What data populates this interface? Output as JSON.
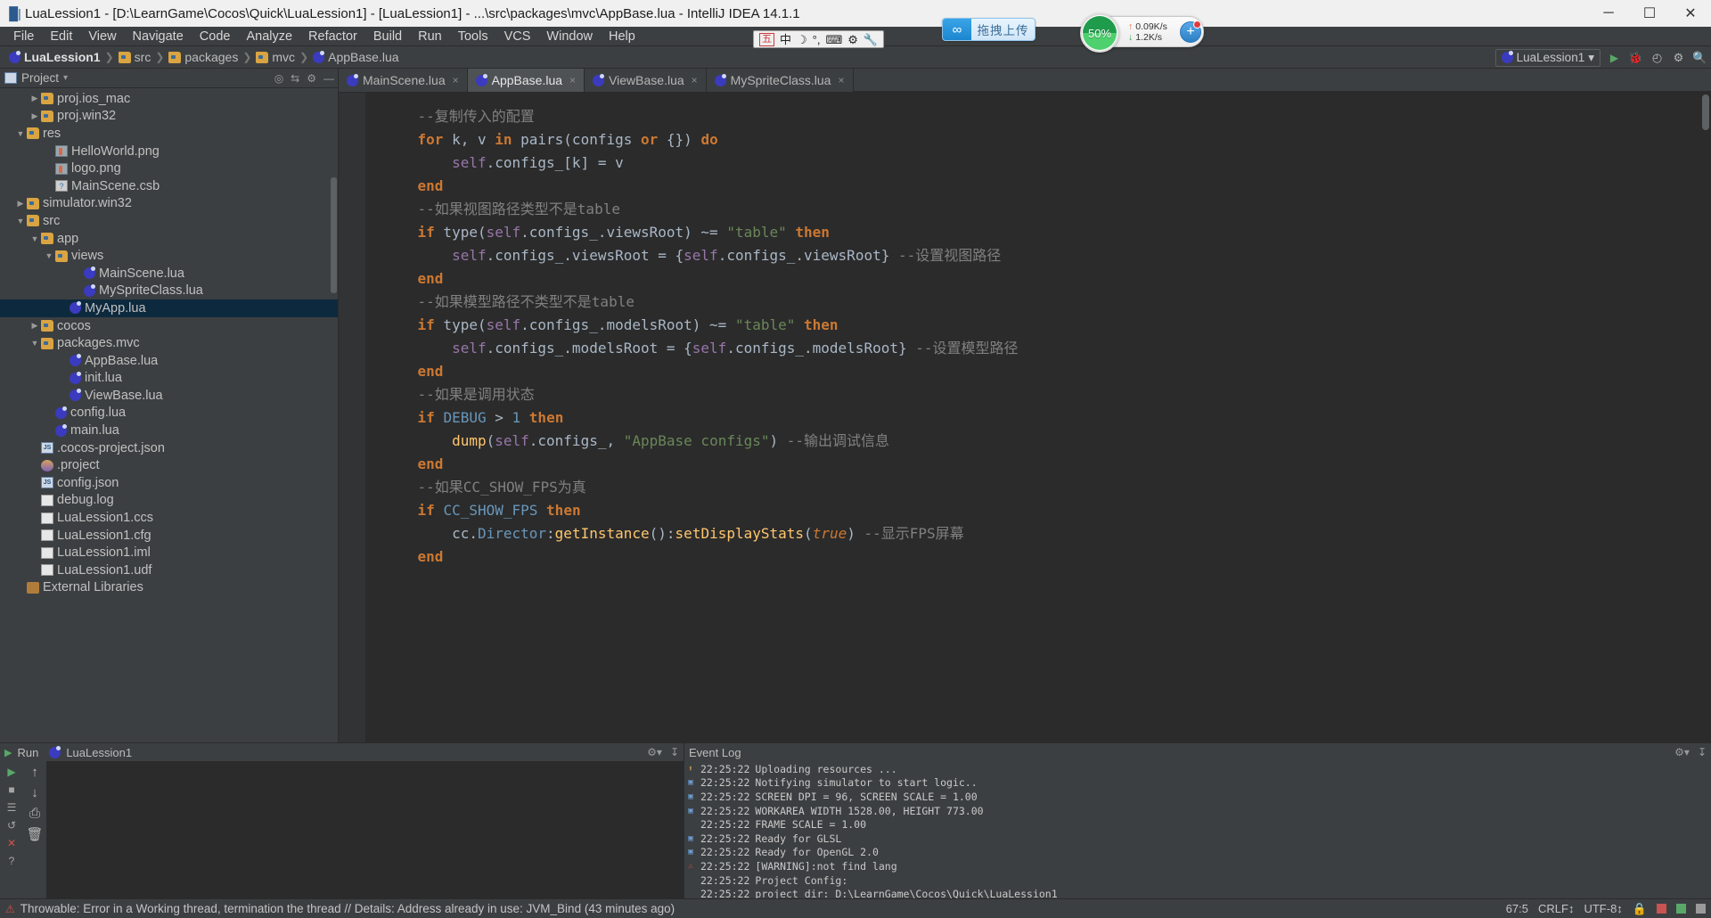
{
  "window": {
    "title": "LuaLession1 - [D:\\LearnGame\\Cocos\\Quick\\LuaLession1] - [LuaLession1] - ...\\src\\packages\\mvc\\AppBase.lua - IntelliJ IDEA 14.1.1",
    "minimize": "─",
    "maximize": "☐",
    "close": "✕"
  },
  "menu": {
    "items": [
      "File",
      "Edit",
      "View",
      "Navigate",
      "Code",
      "Analyze",
      "Refactor",
      "Build",
      "Run",
      "Tools",
      "VCS",
      "Window",
      "Help"
    ]
  },
  "ime": {
    "mode_box": "五",
    "lang": "中",
    "moon": "☽",
    "punct": "°,",
    "keyboard": "⌨",
    "tools": "⚙",
    "wrench": "🔧"
  },
  "upload_widget": {
    "label": "拖拽上传",
    "logo": "∞"
  },
  "net_widget": {
    "percent": "50%",
    "up_arrow": "↑",
    "up_speed": "0.09K/s",
    "down_arrow": "↓",
    "down_speed": "1.2K/s",
    "plus": "+"
  },
  "breadcrumb": {
    "items": [
      {
        "label": "LuaLession1",
        "icon": "project-icon"
      },
      {
        "label": "src",
        "icon": "folder-icon"
      },
      {
        "label": "packages",
        "icon": "folder-icon"
      },
      {
        "label": "mvc",
        "icon": "folder-icon"
      },
      {
        "label": "AppBase.lua",
        "icon": "lua-file-icon"
      }
    ],
    "separator": "❯"
  },
  "toolbar_right": {
    "run_config": "LuaLession1",
    "chevron": "▾",
    "run": "▶",
    "debug": "🐞",
    "coverage": "◴",
    "settings": "⚙",
    "search": "🔍"
  },
  "project_panel": {
    "title": "Project",
    "chevron": "▾",
    "icons": [
      "collapse-all-icon",
      "target-icon",
      "settings-icon",
      "hide-icon"
    ],
    "tree": [
      {
        "indent": 2,
        "twisty": "▶",
        "icon": "folder",
        "label": "proj.ios_mac",
        "selected": false
      },
      {
        "indent": 2,
        "twisty": "▶",
        "icon": "folder",
        "label": "proj.win32",
        "selected": false
      },
      {
        "indent": 1,
        "twisty": "▼",
        "icon": "folder",
        "label": "res",
        "selected": false
      },
      {
        "indent": 3,
        "twisty": "",
        "icon": "png",
        "label": "HelloWorld.png",
        "selected": false
      },
      {
        "indent": 3,
        "twisty": "",
        "icon": "png",
        "label": "logo.png",
        "selected": false
      },
      {
        "indent": 3,
        "twisty": "",
        "icon": "csb",
        "label": "MainScene.csb",
        "selected": false
      },
      {
        "indent": 1,
        "twisty": "▶",
        "icon": "folder",
        "label": "simulator.win32",
        "selected": false
      },
      {
        "indent": 1,
        "twisty": "▼",
        "icon": "folder",
        "label": "src",
        "selected": false
      },
      {
        "indent": 2,
        "twisty": "▼",
        "icon": "folder",
        "label": "app",
        "selected": false
      },
      {
        "indent": 3,
        "twisty": "▼",
        "icon": "folder",
        "label": "views",
        "selected": false
      },
      {
        "indent": 5,
        "twisty": "",
        "icon": "lua",
        "label": "MainScene.lua",
        "selected": false
      },
      {
        "indent": 5,
        "twisty": "",
        "icon": "lua",
        "label": "MySpriteClass.lua",
        "selected": false
      },
      {
        "indent": 4,
        "twisty": "",
        "icon": "lua",
        "label": "MyApp.lua",
        "selected": true
      },
      {
        "indent": 2,
        "twisty": "▶",
        "icon": "folder",
        "label": "cocos",
        "selected": false
      },
      {
        "indent": 2,
        "twisty": "▼",
        "icon": "folder",
        "label": "packages.mvc",
        "selected": false
      },
      {
        "indent": 4,
        "twisty": "",
        "icon": "lua",
        "label": "AppBase.lua",
        "selected": false
      },
      {
        "indent": 4,
        "twisty": "",
        "icon": "lua",
        "label": "init.lua",
        "selected": false
      },
      {
        "indent": 4,
        "twisty": "",
        "icon": "lua",
        "label": "ViewBase.lua",
        "selected": false
      },
      {
        "indent": 3,
        "twisty": "",
        "icon": "lua",
        "label": "config.lua",
        "selected": false
      },
      {
        "indent": 3,
        "twisty": "",
        "icon": "lua",
        "label": "main.lua",
        "selected": false
      },
      {
        "indent": 2,
        "twisty": "",
        "icon": "json",
        "label": ".cocos-project.json",
        "selected": false
      },
      {
        "indent": 2,
        "twisty": "",
        "icon": "proj",
        "label": ".project",
        "selected": false
      },
      {
        "indent": 2,
        "twisty": "",
        "icon": "json",
        "label": "config.json",
        "selected": false
      },
      {
        "indent": 2,
        "twisty": "",
        "icon": "txt",
        "label": "debug.log",
        "selected": false
      },
      {
        "indent": 2,
        "twisty": "",
        "icon": "ccs",
        "label": "LuaLession1.ccs",
        "selected": false
      },
      {
        "indent": 2,
        "twisty": "",
        "icon": "txt",
        "label": "LuaLession1.cfg",
        "selected": false
      },
      {
        "indent": 2,
        "twisty": "",
        "icon": "iml",
        "label": "LuaLession1.iml",
        "selected": false
      },
      {
        "indent": 2,
        "twisty": "",
        "icon": "txt",
        "label": "LuaLession1.udf",
        "selected": false
      },
      {
        "indent": 1,
        "twisty": "",
        "icon": "lib",
        "label": "External Libraries",
        "selected": false
      }
    ]
  },
  "editor": {
    "tabs": [
      {
        "label": "MainScene.lua",
        "active": false,
        "close": "×"
      },
      {
        "label": "AppBase.lua",
        "active": true,
        "close": "×"
      },
      {
        "label": "ViewBase.lua",
        "active": false,
        "close": "×"
      },
      {
        "label": "MySpriteClass.lua",
        "active": false,
        "close": "×"
      }
    ],
    "code_lines": [
      [
        {
          "t": "    ",
          "c": "pl"
        },
        {
          "t": "--复制传入的配置",
          "c": "cm"
        }
      ],
      [
        {
          "t": "    ",
          "c": "pl"
        },
        {
          "t": "for",
          "c": "kw"
        },
        {
          "t": " k, v ",
          "c": "pl"
        },
        {
          "t": "in",
          "c": "kw"
        },
        {
          "t": " pairs(configs ",
          "c": "pl"
        },
        {
          "t": "or",
          "c": "kw"
        },
        {
          "t": " {}) ",
          "c": "pl"
        },
        {
          "t": "do",
          "c": "kw"
        }
      ],
      [
        {
          "t": "        ",
          "c": "pl"
        },
        {
          "t": "self",
          "c": "self"
        },
        {
          "t": ".configs_[k] = v",
          "c": "pl"
        }
      ],
      [
        {
          "t": "    ",
          "c": "pl"
        },
        {
          "t": "end",
          "c": "kw"
        }
      ],
      [
        {
          "t": "    ",
          "c": "pl"
        },
        {
          "t": "--如果视图路径类型不是table",
          "c": "cm"
        }
      ],
      [
        {
          "t": "    ",
          "c": "pl"
        },
        {
          "t": "if",
          "c": "kw"
        },
        {
          "t": " type(",
          "c": "pl"
        },
        {
          "t": "self",
          "c": "self"
        },
        {
          "t": ".configs_.viewsRoot) ~= ",
          "c": "pl"
        },
        {
          "t": "\"table\"",
          "c": "str"
        },
        {
          "t": " ",
          "c": "pl"
        },
        {
          "t": "then",
          "c": "kw"
        }
      ],
      [
        {
          "t": "        ",
          "c": "pl"
        },
        {
          "t": "self",
          "c": "self"
        },
        {
          "t": ".configs_.viewsRoot = {",
          "c": "pl"
        },
        {
          "t": "self",
          "c": "self"
        },
        {
          "t": ".configs_.viewsRoot} ",
          "c": "pl"
        },
        {
          "t": "--设置视图路径",
          "c": "cm"
        }
      ],
      [
        {
          "t": "    ",
          "c": "pl"
        },
        {
          "t": "end",
          "c": "kw"
        }
      ],
      [
        {
          "t": "    ",
          "c": "pl"
        },
        {
          "t": "--如果模型路径不类型不是table",
          "c": "cm"
        }
      ],
      [
        {
          "t": "    ",
          "c": "pl"
        },
        {
          "t": "if",
          "c": "kw"
        },
        {
          "t": " type(",
          "c": "pl"
        },
        {
          "t": "self",
          "c": "self"
        },
        {
          "t": ".configs_.modelsRoot) ~= ",
          "c": "pl"
        },
        {
          "t": "\"table\"",
          "c": "str"
        },
        {
          "t": " ",
          "c": "pl"
        },
        {
          "t": "then",
          "c": "kw"
        }
      ],
      [
        {
          "t": "        ",
          "c": "pl"
        },
        {
          "t": "self",
          "c": "self"
        },
        {
          "t": ".configs_.modelsRoot = {",
          "c": "pl"
        },
        {
          "t": "self",
          "c": "self"
        },
        {
          "t": ".configs_.modelsRoot} ",
          "c": "pl"
        },
        {
          "t": "--设置模型路径",
          "c": "cm"
        }
      ],
      [
        {
          "t": "    ",
          "c": "pl"
        },
        {
          "t": "end",
          "c": "kw"
        }
      ],
      [
        {
          "t": "    ",
          "c": "pl"
        },
        {
          "t": "--如果是调用状态",
          "c": "cm"
        }
      ],
      [
        {
          "t": "    ",
          "c": "pl"
        },
        {
          "t": "if",
          "c": "kw"
        },
        {
          "t": " ",
          "c": "pl"
        },
        {
          "t": "DEBUG",
          "c": "num"
        },
        {
          "t": " > ",
          "c": "pl"
        },
        {
          "t": "1",
          "c": "num"
        },
        {
          "t": " ",
          "c": "pl"
        },
        {
          "t": "then",
          "c": "kw"
        }
      ],
      [
        {
          "t": "        ",
          "c": "pl"
        },
        {
          "t": "dump",
          "c": "fn"
        },
        {
          "t": "(",
          "c": "pl"
        },
        {
          "t": "self",
          "c": "self"
        },
        {
          "t": ".configs_, ",
          "c": "pl"
        },
        {
          "t": "\"AppBase configs\"",
          "c": "str"
        },
        {
          "t": ") ",
          "c": "pl"
        },
        {
          "t": "--输出调试信息",
          "c": "cm"
        }
      ],
      [
        {
          "t": "    ",
          "c": "pl"
        },
        {
          "t": "end",
          "c": "kw"
        }
      ],
      [
        {
          "t": "    ",
          "c": "pl"
        },
        {
          "t": "--如果CC_SHOW_FPS为真",
          "c": "cm"
        }
      ],
      [
        {
          "t": "    ",
          "c": "pl"
        },
        {
          "t": "if",
          "c": "kw"
        },
        {
          "t": " ",
          "c": "pl"
        },
        {
          "t": "CC_SHOW_FPS",
          "c": "num"
        },
        {
          "t": " ",
          "c": "pl"
        },
        {
          "t": "then",
          "c": "kw"
        }
      ],
      [
        {
          "t": "        cc.",
          "c": "pl"
        },
        {
          "t": "Director",
          "c": "num"
        },
        {
          "t": ":",
          "c": "pl"
        },
        {
          "t": "getInstance",
          "c": "fn"
        },
        {
          "t": "()",
          "c": "pl"
        },
        {
          "t": ":",
          "c": "pl"
        },
        {
          "t": "setDisplayStats",
          "c": "fn"
        },
        {
          "t": "(",
          "c": "pl"
        },
        {
          "t": "true",
          "c": "ital"
        },
        {
          "t": ") ",
          "c": "pl"
        },
        {
          "t": "--显示FPS屏幕",
          "c": "cm"
        }
      ],
      [
        {
          "t": "    ",
          "c": "pl"
        },
        {
          "t": "end",
          "c": "kw"
        }
      ]
    ]
  },
  "run_panel": {
    "title": "Run",
    "config_name": "LuaLession1",
    "toolbar_icons": [
      "run-icon",
      "rerun-icon",
      "stop-icon",
      "pause-icon",
      "trash-icon",
      "down-arrow-icon",
      "up-arrow-icon",
      "help-icon",
      "wrap-icon",
      "print-icon"
    ],
    "head_icons": [
      "settings-icon",
      "hide-icon"
    ]
  },
  "event_log": {
    "title": "Event Log",
    "head_icons": [
      "settings-icon",
      "hide-icon"
    ],
    "entries": [
      {
        "badge": "upload",
        "time": "22:25:22",
        "message": "Uploading resources ..."
      },
      {
        "badge": "info",
        "time": "22:25:22",
        "message": "Notifying simulator to start logic.."
      },
      {
        "badge": "info",
        "time": "22:25:22",
        "message": "SCREEN DPI = 96, SCREEN SCALE = 1.00"
      },
      {
        "badge": "info",
        "time": "22:25:22",
        "message": "WORKAREA WIDTH 1528.00, HEIGHT 773.00"
      },
      {
        "badge": "none",
        "time": "22:25:22",
        "message": "FRAME SCALE = 1.00"
      },
      {
        "badge": "info",
        "time": "22:25:22",
        "message": "Ready for GLSL"
      },
      {
        "badge": "info",
        "time": "22:25:22",
        "message": "Ready for OpenGL 2.0"
      },
      {
        "badge": "warn",
        "time": "22:25:22",
        "message": "[WARNING]:not find lang"
      },
      {
        "badge": "none",
        "time": "22:25:22",
        "message": "Project Config:"
      },
      {
        "badge": "none",
        "time": "22:25:22",
        "message": "project dir: D:\\LearnGame\\Cocos\\Quick\\LuaLession1"
      }
    ]
  },
  "status_bar": {
    "error_icon": "⚠",
    "message": "Throwable: Error in a Working thread, termination the thread // Details: Address already in use: JVM_Bind (43 minutes ago)",
    "caret": "67:5",
    "line_sep": "CRLF↕",
    "encoding": "UTF-8↕",
    "lock_icon": "🔒",
    "indicators": [
      "red",
      "green",
      "gray"
    ]
  }
}
